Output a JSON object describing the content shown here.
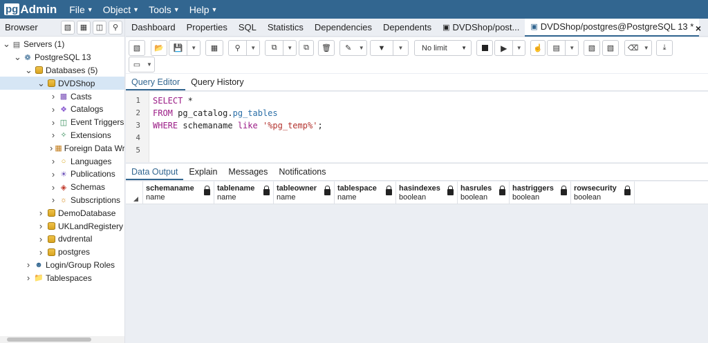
{
  "navbar": {
    "logo_pg": "pg",
    "logo_admin": "Admin",
    "menus": [
      "File",
      "Object",
      "Tools",
      "Help"
    ]
  },
  "browser": {
    "title": "Browser",
    "tree": [
      {
        "label": "Servers (1)",
        "arrow": "down",
        "icon": "servers-icon"
      },
      {
        "label": "PostgreSQL 13",
        "arrow": "down",
        "icon": "elephant-icon"
      },
      {
        "label": "Databases (5)",
        "arrow": "down",
        "icon": "databases-icon"
      },
      {
        "label": "DVDShop",
        "arrow": "down",
        "icon": "database-icon",
        "selected": true
      },
      {
        "label": "Casts",
        "arrow": "right",
        "icon": "casts-icon"
      },
      {
        "label": "Catalogs",
        "arrow": "right",
        "icon": "catalogs-icon"
      },
      {
        "label": "Event Triggers",
        "arrow": "right",
        "icon": "event-triggers-icon"
      },
      {
        "label": "Extensions",
        "arrow": "right",
        "icon": "extensions-icon"
      },
      {
        "label": "Foreign Data Wr",
        "arrow": "right",
        "icon": "foreign-data-icon"
      },
      {
        "label": "Languages",
        "arrow": "right",
        "icon": "languages-icon"
      },
      {
        "label": "Publications",
        "arrow": "right",
        "icon": "publications-icon"
      },
      {
        "label": "Schemas",
        "arrow": "right",
        "icon": "schemas-icon"
      },
      {
        "label": "Subscriptions",
        "arrow": "right",
        "icon": "subscriptions-icon"
      },
      {
        "label": "DemoDatabase",
        "arrow": "right",
        "icon": "database-icon"
      },
      {
        "label": "UKLandRegistery",
        "arrow": "right",
        "icon": "database-icon"
      },
      {
        "label": "dvdrental",
        "arrow": "right",
        "icon": "database-icon"
      },
      {
        "label": "postgres",
        "arrow": "right",
        "icon": "database-icon"
      },
      {
        "label": "Login/Group Roles",
        "arrow": "right",
        "icon": "roles-icon"
      },
      {
        "label": "Tablespaces",
        "arrow": "right",
        "icon": "tablespaces-icon"
      }
    ]
  },
  "tabs": {
    "items": [
      "Dashboard",
      "Properties",
      "SQL",
      "Statistics",
      "Dependencies",
      "Dependents"
    ],
    "query_tab_short": "DVDShop/post...",
    "query_tab_active": "DVDShop/postgres@PostgreSQL 13 *",
    "close": "×"
  },
  "toolbar": {
    "limit_label": "No limit"
  },
  "editor": {
    "tabs": [
      "Query Editor",
      "Query History"
    ],
    "line_numbers": [
      "1",
      "2",
      "3",
      "4",
      "5"
    ]
  },
  "output": {
    "tabs": [
      "Data Output",
      "Explain",
      "Messages",
      "Notifications"
    ],
    "columns": [
      {
        "name": "schemaname",
        "type": "name"
      },
      {
        "name": "tablename",
        "type": "name"
      },
      {
        "name": "tableowner",
        "type": "name"
      },
      {
        "name": "tablespace",
        "type": "name"
      },
      {
        "name": "hasindexes",
        "type": "boolean"
      },
      {
        "name": "hasrules",
        "type": "boolean"
      },
      {
        "name": "hastriggers",
        "type": "boolean"
      },
      {
        "name": "rowsecurity",
        "type": "boolean"
      }
    ]
  },
  "sql": {
    "l1_kw": "SELECT",
    "l1_rest": " *",
    "l2_kw": "FROM",
    "l2_schema": " pg_catalog.",
    "l2_table": "pg_tables",
    "l3_kw": "WHERE",
    "l3_col": " schemaname ",
    "l3_like": "like",
    "l3_str": " '%pg_temp%'",
    "l3_end": ";"
  },
  "colors": {
    "navbar": "#326690",
    "accent": "#326690",
    "selected_row": "#d6e6f5"
  }
}
